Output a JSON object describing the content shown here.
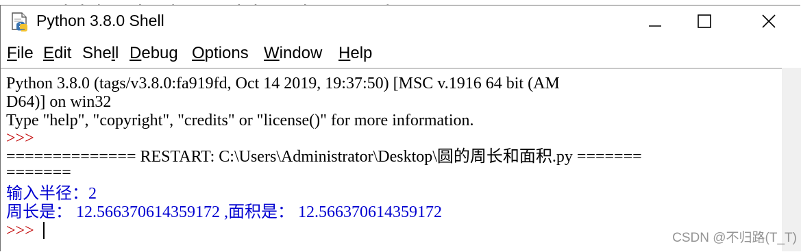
{
  "window": {
    "title": "Python 3.8.0 Shell",
    "icon": "python-idle-icon",
    "controls": [
      "minimize-icon",
      "maximize-icon",
      "close-icon"
    ]
  },
  "menu": {
    "file": {
      "first": "F",
      "rest": "ile"
    },
    "edit": {
      "first": "E",
      "rest": "dit"
    },
    "shell": {
      "before": "She",
      "underlined": "l",
      "after": "l"
    },
    "debug": {
      "first": "D",
      "rest": "ebug"
    },
    "options": {
      "first": "O",
      "rest": "ptions"
    },
    "window": {
      "first": "W",
      "rest": "indow"
    },
    "help": {
      "first": "H",
      "rest": "elp"
    }
  },
  "shell": {
    "banner_line1": "Python 3.8.0 (tags/v3.8.0:fa919fd, Oct 14 2019, 19:37:50) [MSC v.1916 64 bit (AM",
    "banner_line2": "D64)] on win32",
    "banner_line3": "Type \"help\", \"copyright\", \"credits\" or \"license()\" for more information.",
    "prompt": ">>>",
    "restart_line1": "============== RESTART: C:\\Users\\Administrator\\Desktop\\圆的周长和面积.py =======",
    "restart_line2": "=======",
    "output_line1": "输入半径：2",
    "output_line2": "周长是： 12.566370614359172 ,面积是： 12.566370614359172"
  },
  "watermark": "CSDN @不归路(T_T)",
  "colors": {
    "prompt": "#c00000",
    "stdout": "#0000d0",
    "text": "#000000"
  }
}
